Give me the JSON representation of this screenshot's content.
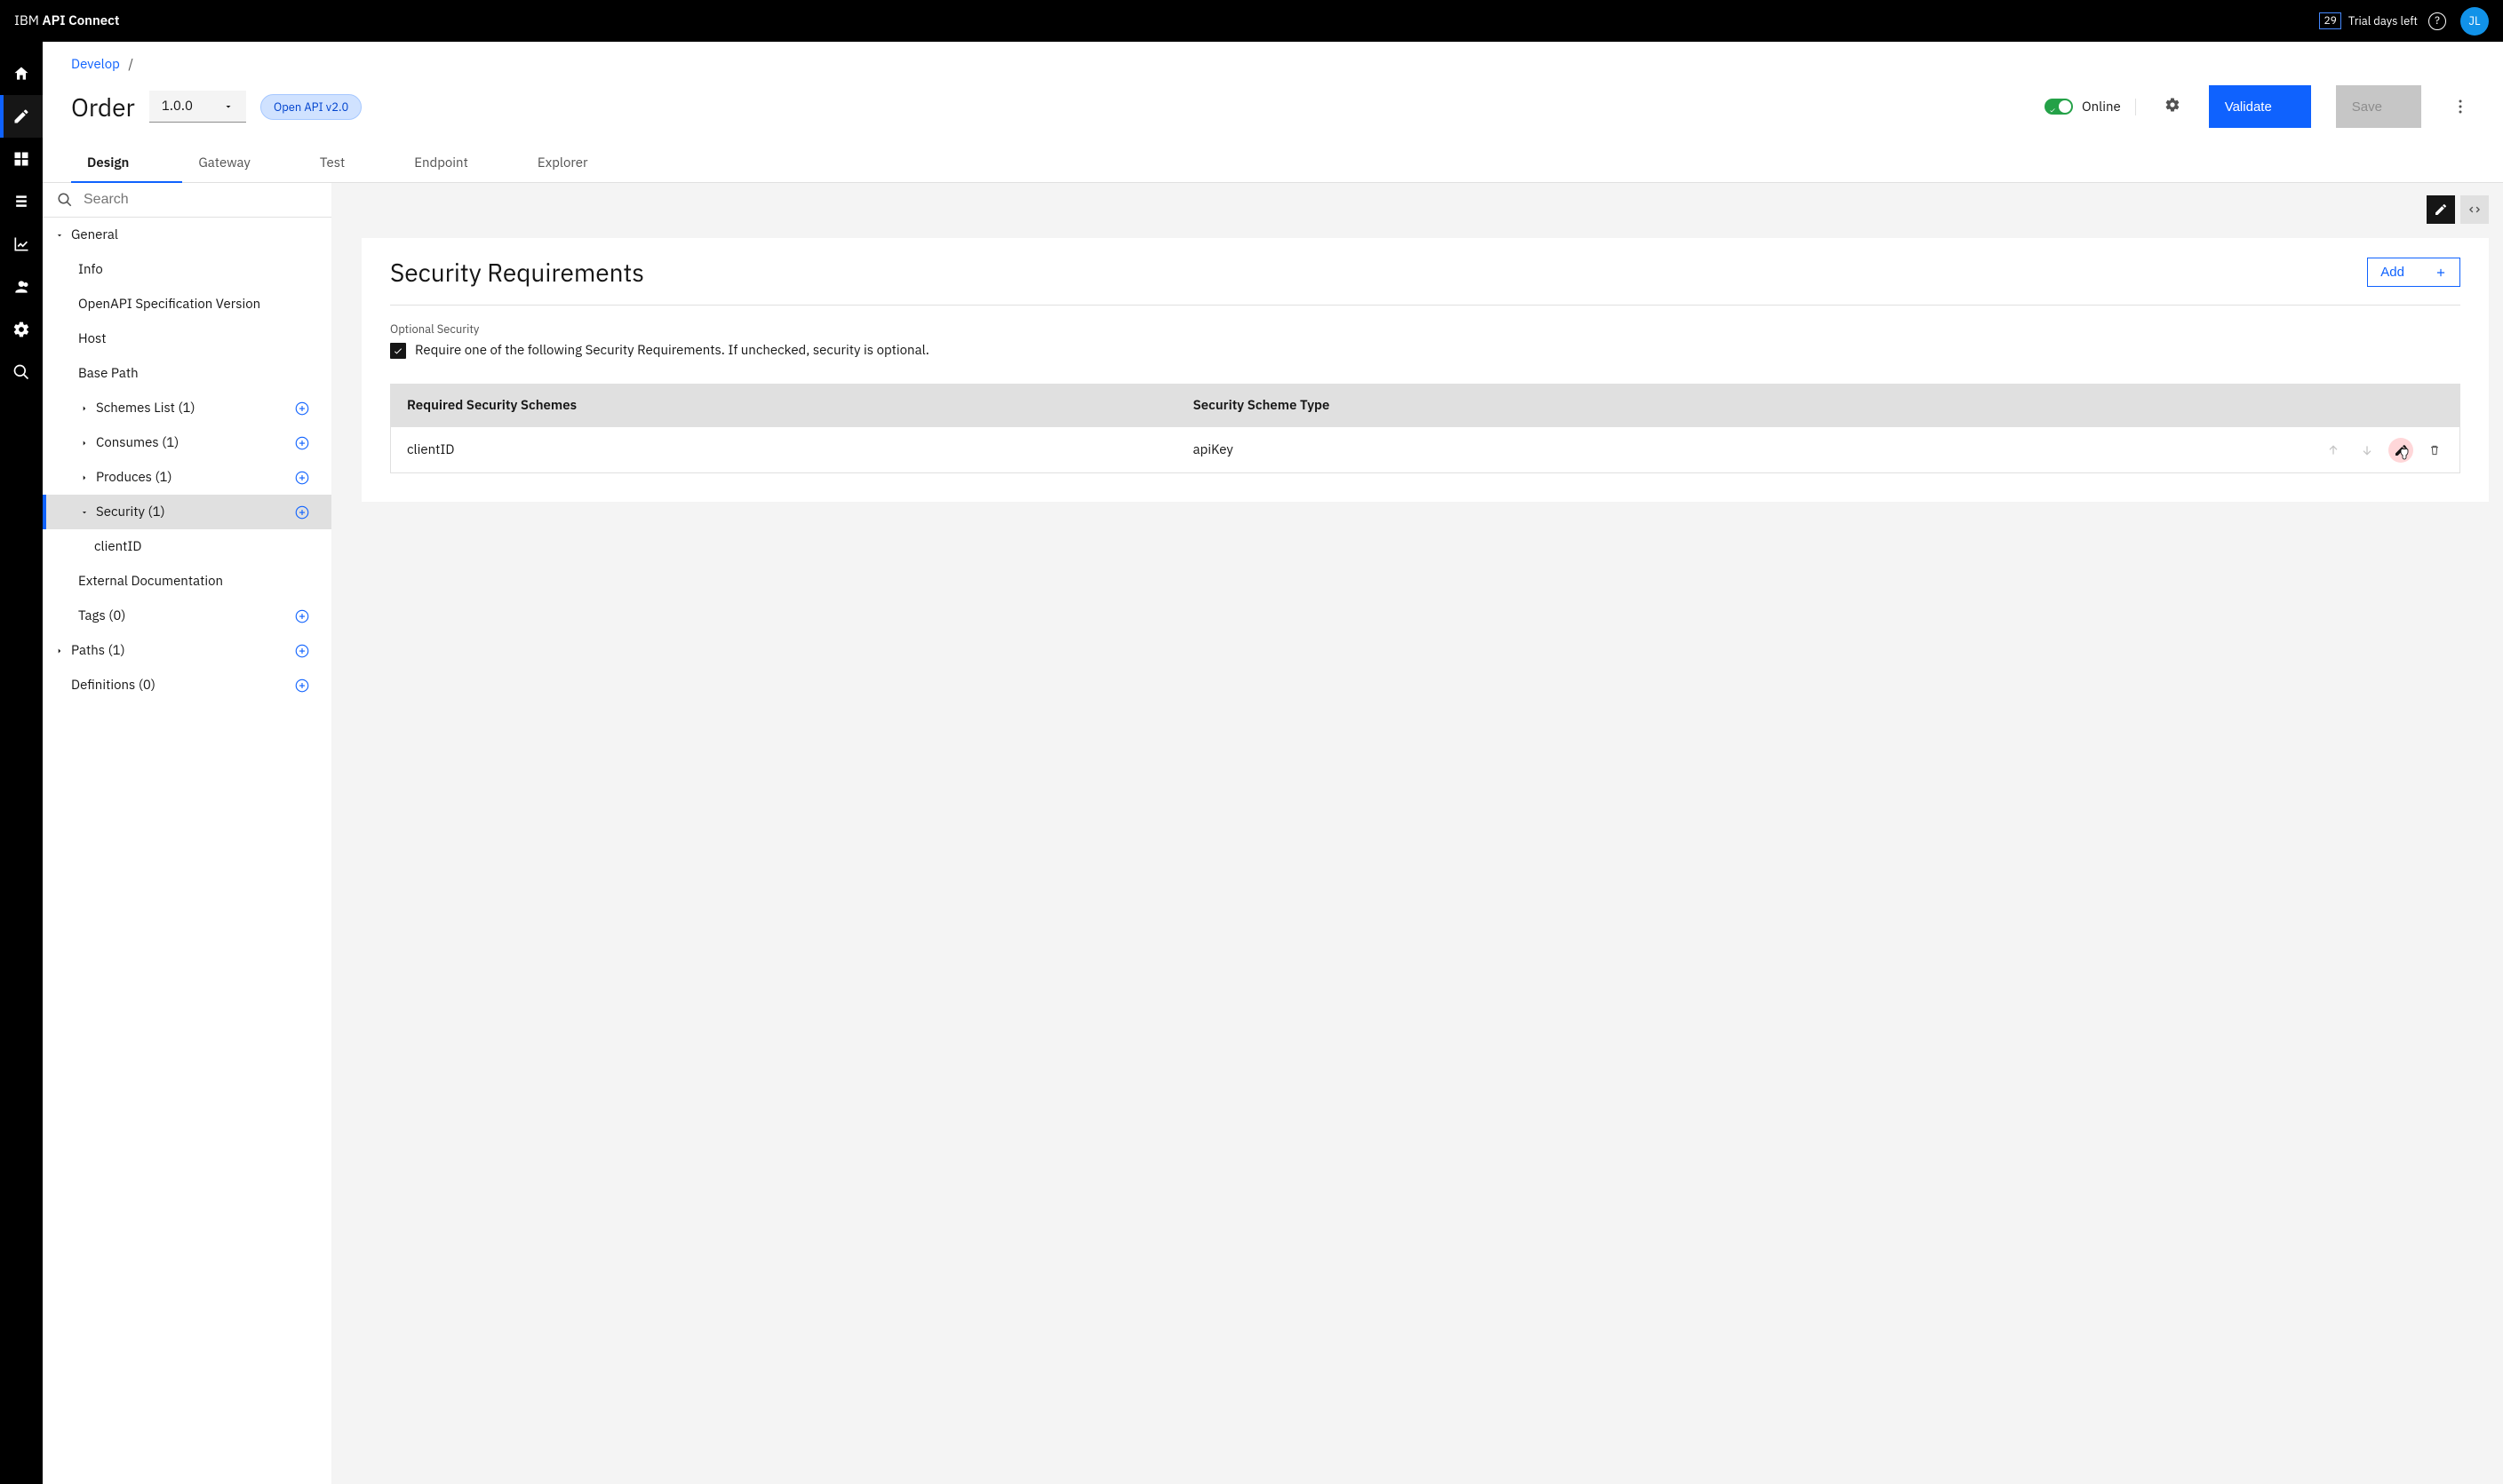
{
  "topbar": {
    "brand_prefix": "IBM ",
    "brand_name": "API Connect",
    "trial_days": "29",
    "trial_label": "Trial days left",
    "avatar_initials": "JL"
  },
  "breadcrumb": {
    "develop": "Develop"
  },
  "header": {
    "title": "Order",
    "version": "1.0.0",
    "spec_badge": "Open API v2.0",
    "online_label": "Online",
    "validate": "Validate",
    "save": "Save"
  },
  "tabs": [
    {
      "label": "Design",
      "active": true
    },
    {
      "label": "Gateway"
    },
    {
      "label": "Test"
    },
    {
      "label": "Endpoint"
    },
    {
      "label": "Explorer"
    }
  ],
  "search_placeholder": "Search",
  "tree": {
    "general": "General",
    "info": "Info",
    "openapi": "OpenAPI Specification Version",
    "host": "Host",
    "basepath": "Base Path",
    "schemes": "Schemes List (1)",
    "consumes": "Consumes (1)",
    "produces": "Produces (1)",
    "security": "Security (1)",
    "clientid": "clientID",
    "extdoc": "External Documentation",
    "tags": "Tags (0)",
    "paths": "Paths (1)",
    "definitions": "Definitions (0)"
  },
  "panel": {
    "title": "Security Requirements",
    "add_label": "Add",
    "optional_label": "Optional Security",
    "require_text": "Require one of the following Security Requirements. If unchecked, security is optional.",
    "col1": "Required Security Schemes",
    "col2": "Security Scheme Type",
    "rows": [
      {
        "scheme": "clientID",
        "type": "apiKey"
      }
    ]
  }
}
